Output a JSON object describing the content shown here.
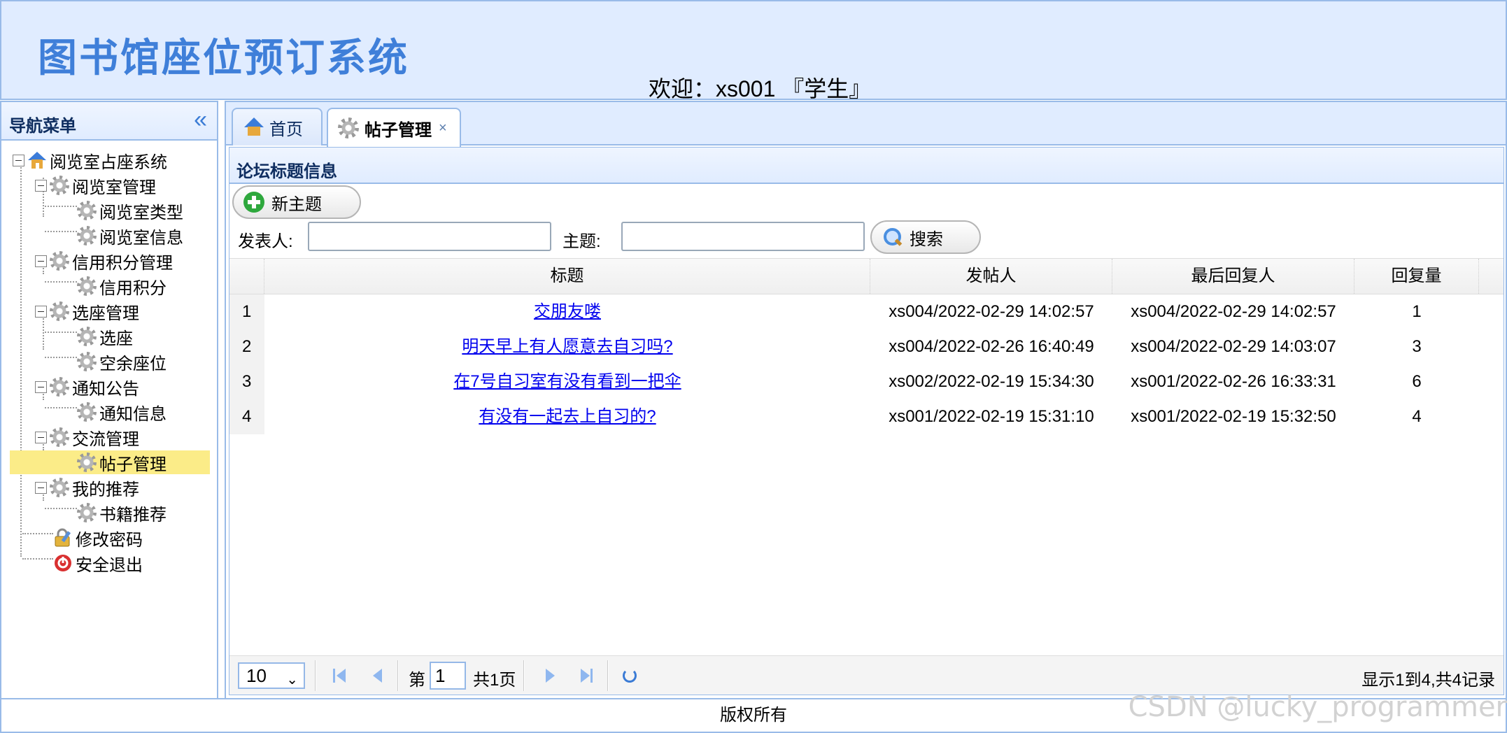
{
  "header": {
    "app_title": "图书馆座位预订系统",
    "welcome": "欢迎：xs001 『学生』"
  },
  "nav": {
    "title": "导航菜单",
    "collapse_icon": "double-chevron-left-icon",
    "tree": [
      {
        "label": "阅览室占座系统",
        "icon": "home-icon"
      },
      {
        "label": "阅览室管理",
        "icon": "gear-icon"
      },
      {
        "label": "阅览室类型",
        "icon": "gear-icon"
      },
      {
        "label": "阅览室信息",
        "icon": "gear-icon"
      },
      {
        "label": "信用积分管理",
        "icon": "gear-icon"
      },
      {
        "label": "信用积分",
        "icon": "gear-icon"
      },
      {
        "label": "选座管理",
        "icon": "gear-icon"
      },
      {
        "label": "选座",
        "icon": "gear-icon"
      },
      {
        "label": "空余座位",
        "icon": "gear-icon"
      },
      {
        "label": "通知公告",
        "icon": "gear-icon"
      },
      {
        "label": "通知信息",
        "icon": "gear-icon"
      },
      {
        "label": "交流管理",
        "icon": "gear-icon"
      },
      {
        "label": "帖子管理",
        "icon": "gear-icon",
        "selected": true
      },
      {
        "label": "我的推荐",
        "icon": "gear-icon"
      },
      {
        "label": "书籍推荐",
        "icon": "gear-icon"
      },
      {
        "label": "修改密码",
        "icon": "lock-edit-icon"
      },
      {
        "label": "安全退出",
        "icon": "exit-icon"
      }
    ]
  },
  "tabs": [
    {
      "label": "首页",
      "icon": "home-icon"
    },
    {
      "label": "帖子管理",
      "icon": "gear-icon",
      "active": true,
      "close": "×"
    }
  ],
  "panel": {
    "title": "论坛标题信息",
    "new_topic_button": "新主题",
    "poster_label": "发表人:",
    "poster_value": "",
    "subject_label": "主题:",
    "subject_value": "",
    "search_button": "搜索"
  },
  "grid": {
    "columns": [
      "标题",
      "发帖人",
      "最后回复人",
      "回复量"
    ],
    "rows": [
      {
        "num": "1",
        "title": "交朋友喽",
        "poster": "xs004/2022-02-29 14:02:57",
        "last_reply": "xs004/2022-02-29 14:02:57",
        "replies": "1"
      },
      {
        "num": "2",
        "title": "明天早上有人愿意去自习吗?",
        "poster": "xs004/2022-02-26 16:40:49",
        "last_reply": "xs004/2022-02-29 14:03:07",
        "replies": "3"
      },
      {
        "num": "3",
        "title": "在7号自习室有没有看到一把伞",
        "poster": "xs002/2022-02-19 15:34:30",
        "last_reply": "xs001/2022-02-26 16:33:31",
        "replies": "6"
      },
      {
        "num": "4",
        "title": "有没有一起去上自习的?",
        "poster": "xs001/2022-02-19 15:31:10",
        "last_reply": "xs001/2022-02-19 15:32:50",
        "replies": "4"
      }
    ]
  },
  "pager": {
    "page_size": "10",
    "page_prefix": "第",
    "page_value": "1",
    "page_total": "共1页",
    "info": "显示1到4,共4记录"
  },
  "footer": {
    "text": "版权所有"
  },
  "watermark": "CSDN @lucky_programmer"
}
